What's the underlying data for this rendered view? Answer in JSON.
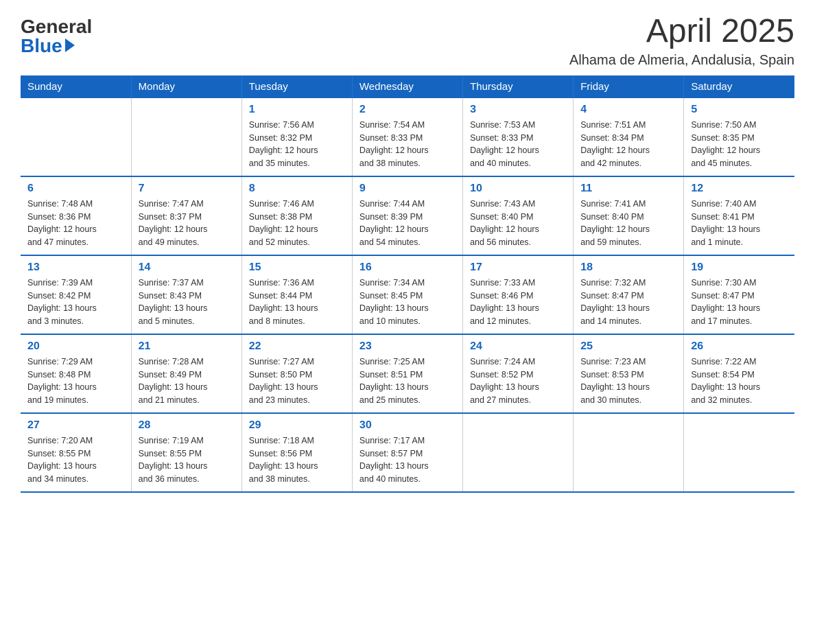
{
  "header": {
    "logo_general": "General",
    "logo_blue": "Blue",
    "month_year": "April 2025",
    "location": "Alhama de Almeria, Andalusia, Spain"
  },
  "days_of_week": [
    "Sunday",
    "Monday",
    "Tuesday",
    "Wednesday",
    "Thursday",
    "Friday",
    "Saturday"
  ],
  "weeks": [
    [
      {
        "day": "",
        "info": ""
      },
      {
        "day": "",
        "info": ""
      },
      {
        "day": "1",
        "info": "Sunrise: 7:56 AM\nSunset: 8:32 PM\nDaylight: 12 hours\nand 35 minutes."
      },
      {
        "day": "2",
        "info": "Sunrise: 7:54 AM\nSunset: 8:33 PM\nDaylight: 12 hours\nand 38 minutes."
      },
      {
        "day": "3",
        "info": "Sunrise: 7:53 AM\nSunset: 8:33 PM\nDaylight: 12 hours\nand 40 minutes."
      },
      {
        "day": "4",
        "info": "Sunrise: 7:51 AM\nSunset: 8:34 PM\nDaylight: 12 hours\nand 42 minutes."
      },
      {
        "day": "5",
        "info": "Sunrise: 7:50 AM\nSunset: 8:35 PM\nDaylight: 12 hours\nand 45 minutes."
      }
    ],
    [
      {
        "day": "6",
        "info": "Sunrise: 7:48 AM\nSunset: 8:36 PM\nDaylight: 12 hours\nand 47 minutes."
      },
      {
        "day": "7",
        "info": "Sunrise: 7:47 AM\nSunset: 8:37 PM\nDaylight: 12 hours\nand 49 minutes."
      },
      {
        "day": "8",
        "info": "Sunrise: 7:46 AM\nSunset: 8:38 PM\nDaylight: 12 hours\nand 52 minutes."
      },
      {
        "day": "9",
        "info": "Sunrise: 7:44 AM\nSunset: 8:39 PM\nDaylight: 12 hours\nand 54 minutes."
      },
      {
        "day": "10",
        "info": "Sunrise: 7:43 AM\nSunset: 8:40 PM\nDaylight: 12 hours\nand 56 minutes."
      },
      {
        "day": "11",
        "info": "Sunrise: 7:41 AM\nSunset: 8:40 PM\nDaylight: 12 hours\nand 59 minutes."
      },
      {
        "day": "12",
        "info": "Sunrise: 7:40 AM\nSunset: 8:41 PM\nDaylight: 13 hours\nand 1 minute."
      }
    ],
    [
      {
        "day": "13",
        "info": "Sunrise: 7:39 AM\nSunset: 8:42 PM\nDaylight: 13 hours\nand 3 minutes."
      },
      {
        "day": "14",
        "info": "Sunrise: 7:37 AM\nSunset: 8:43 PM\nDaylight: 13 hours\nand 5 minutes."
      },
      {
        "day": "15",
        "info": "Sunrise: 7:36 AM\nSunset: 8:44 PM\nDaylight: 13 hours\nand 8 minutes."
      },
      {
        "day": "16",
        "info": "Sunrise: 7:34 AM\nSunset: 8:45 PM\nDaylight: 13 hours\nand 10 minutes."
      },
      {
        "day": "17",
        "info": "Sunrise: 7:33 AM\nSunset: 8:46 PM\nDaylight: 13 hours\nand 12 minutes."
      },
      {
        "day": "18",
        "info": "Sunrise: 7:32 AM\nSunset: 8:47 PM\nDaylight: 13 hours\nand 14 minutes."
      },
      {
        "day": "19",
        "info": "Sunrise: 7:30 AM\nSunset: 8:47 PM\nDaylight: 13 hours\nand 17 minutes."
      }
    ],
    [
      {
        "day": "20",
        "info": "Sunrise: 7:29 AM\nSunset: 8:48 PM\nDaylight: 13 hours\nand 19 minutes."
      },
      {
        "day": "21",
        "info": "Sunrise: 7:28 AM\nSunset: 8:49 PM\nDaylight: 13 hours\nand 21 minutes."
      },
      {
        "day": "22",
        "info": "Sunrise: 7:27 AM\nSunset: 8:50 PM\nDaylight: 13 hours\nand 23 minutes."
      },
      {
        "day": "23",
        "info": "Sunrise: 7:25 AM\nSunset: 8:51 PM\nDaylight: 13 hours\nand 25 minutes."
      },
      {
        "day": "24",
        "info": "Sunrise: 7:24 AM\nSunset: 8:52 PM\nDaylight: 13 hours\nand 27 minutes."
      },
      {
        "day": "25",
        "info": "Sunrise: 7:23 AM\nSunset: 8:53 PM\nDaylight: 13 hours\nand 30 minutes."
      },
      {
        "day": "26",
        "info": "Sunrise: 7:22 AM\nSunset: 8:54 PM\nDaylight: 13 hours\nand 32 minutes."
      }
    ],
    [
      {
        "day": "27",
        "info": "Sunrise: 7:20 AM\nSunset: 8:55 PM\nDaylight: 13 hours\nand 34 minutes."
      },
      {
        "day": "28",
        "info": "Sunrise: 7:19 AM\nSunset: 8:55 PM\nDaylight: 13 hours\nand 36 minutes."
      },
      {
        "day": "29",
        "info": "Sunrise: 7:18 AM\nSunset: 8:56 PM\nDaylight: 13 hours\nand 38 minutes."
      },
      {
        "day": "30",
        "info": "Sunrise: 7:17 AM\nSunset: 8:57 PM\nDaylight: 13 hours\nand 40 minutes."
      },
      {
        "day": "",
        "info": ""
      },
      {
        "day": "",
        "info": ""
      },
      {
        "day": "",
        "info": ""
      }
    ]
  ]
}
